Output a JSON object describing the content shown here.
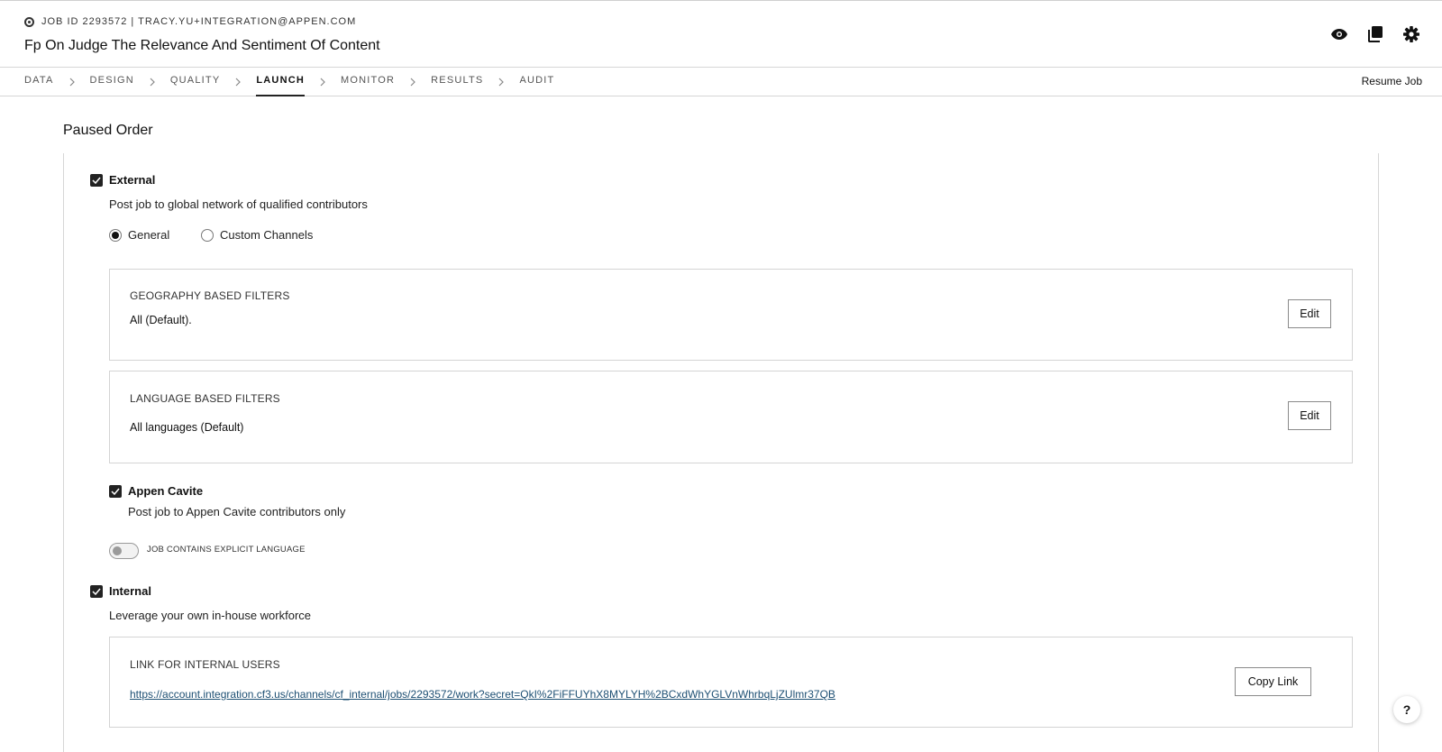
{
  "header": {
    "job_meta": "JOB ID 2293572 | TRACY.YU+INTEGRATION@APPEN.COM",
    "title": "Fp On Judge The Relevance And Sentiment Of Content",
    "icons": [
      "eye-icon",
      "copy-icon",
      "gear-icon"
    ]
  },
  "nav": {
    "steps": [
      {
        "label": "DATA",
        "active": false
      },
      {
        "label": "DESIGN",
        "active": false
      },
      {
        "label": "QUALITY",
        "active": false
      },
      {
        "label": "LAUNCH",
        "active": true
      },
      {
        "label": "MONITOR",
        "active": false
      },
      {
        "label": "RESULTS",
        "active": false
      },
      {
        "label": "AUDIT",
        "active": false
      }
    ],
    "resume_label": "Resume Job"
  },
  "page": {
    "heading": "Paused Order"
  },
  "external": {
    "label": "External",
    "checked": true,
    "description": "Post job to global network of qualified contributors",
    "radio_general": "General",
    "radio_custom": "Custom Channels",
    "selected": "General",
    "geo": {
      "title": "GEOGRAPHY BASED FILTERS",
      "value": "All (Default).",
      "edit_label": "Edit"
    },
    "lang": {
      "title": "LANGUAGE BASED FILTERS",
      "value": "All languages (Default)",
      "edit_label": "Edit"
    },
    "cavite": {
      "label": "Appen Cavite",
      "checked": true,
      "description": "Post job to Appen Cavite contributors only"
    },
    "explicit_toggle": {
      "label": "JOB CONTAINS EXPLICIT LANGUAGE",
      "on": false
    }
  },
  "internal": {
    "label": "Internal",
    "checked": true,
    "description": "Leverage your own in-house workforce",
    "link_box": {
      "title": "LINK FOR INTERNAL USERS",
      "url": "https://account.integration.cf3.us/channels/cf_internal/jobs/2293572/work?secret=QkI%2FiFFUYhX8MYLYH%2BCxdWhYGLVnWhrbqLjZUlmr37QB",
      "copy_label": "Copy Link"
    }
  },
  "help": {
    "label": "?"
  },
  "colors": {
    "text": "#1a1a1a",
    "border": "#d6d6d6",
    "link": "#1d4f73",
    "checkbox": "#222222"
  }
}
